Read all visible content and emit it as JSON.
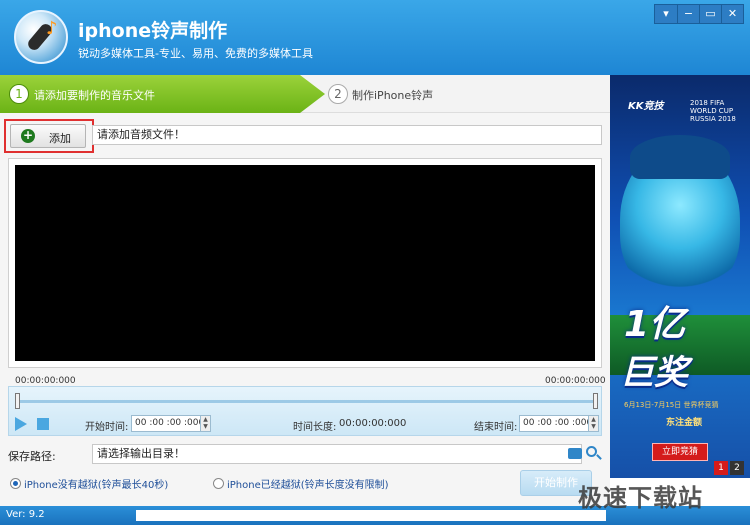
{
  "app": {
    "title": "iphone铃声制作",
    "subtitle": "锐动多媒体工具-专业、易用、免费的多媒体工具"
  },
  "window_controls": [
    "▾",
    "−",
    "▭",
    "✕"
  ],
  "steps": [
    {
      "num": "1",
      "label": "请添加要制作的音乐文件",
      "active": true
    },
    {
      "num": "2",
      "label": "制作iPhone铃声",
      "active": false
    }
  ],
  "toolbar": {
    "add_label": "添加",
    "file_placeholder": "请添加音频文件！"
  },
  "player": {
    "time_start": "00:00:00:000",
    "time_end": "00:00:00:000",
    "start_label": "开始时间:",
    "start_value": "00 :00 :00 :000",
    "duration_label": "时间长度:",
    "duration_value": "00:00:00:000",
    "end_label": "结束时间:",
    "end_value": "00 :00 :00 :000"
  },
  "save": {
    "label": "保存路径:",
    "placeholder": "请选择输出目录！"
  },
  "options": [
    {
      "label": "iPhone没有越狱(铃声最长40秒)",
      "selected": true
    },
    {
      "label": "iPhone已经越狱(铃声长度没有限制)",
      "selected": false
    }
  ],
  "start_button": "开始制作",
  "ad": {
    "brand": "KK竞技",
    "cup": "2018 FIFA WORLD CUP RUSSIA 2018",
    "big_line1": "1亿",
    "big_line2": "巨奖",
    "date": "6月13日-7月15日 世界杯竞猜",
    "slogan": "东注金额",
    "button": "立即竞猜",
    "pages": [
      "1",
      "2"
    ],
    "active_page": "1"
  },
  "status": {
    "version": "Ver: 9.2"
  },
  "watermark": "极速下载站",
  "colors": {
    "accent": "#1e86d4",
    "step_active": "#6bb316",
    "highlight": "#e03030"
  }
}
